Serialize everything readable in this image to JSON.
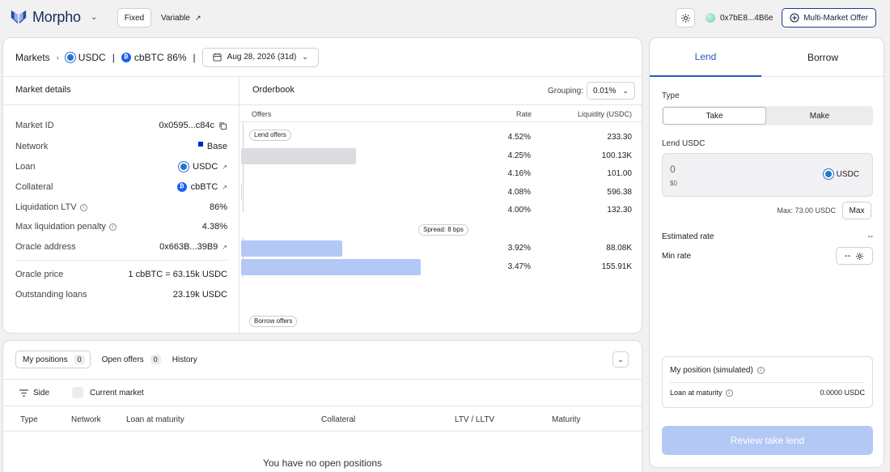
{
  "app": {
    "brand": "Morpho",
    "mode_fixed": "Fixed",
    "mode_variable": "Variable",
    "wallet": "0x7bE8...4B6e",
    "multi_market_offer": "Multi-Market Offer"
  },
  "market": {
    "breadcrumb_root": "Markets",
    "loan_token": "USDC",
    "collateral_token": "cbBTC",
    "ltv": "86%",
    "maturity": "Aug 28, 2026 (31d)"
  },
  "details": {
    "title": "Market details",
    "rows": [
      {
        "label": "Market ID",
        "value": "0x0595...c84c"
      },
      {
        "label": "Network",
        "value": "Base"
      },
      {
        "label": "Loan",
        "value": "USDC"
      },
      {
        "label": "Collateral",
        "value": "cbBTC"
      },
      {
        "label": "Liquidation LTV",
        "value": "86%"
      },
      {
        "label": "Max liquidation penalty",
        "value": "4.38%"
      },
      {
        "label": "Oracle address",
        "value": "0x663B...39B9"
      },
      {
        "label": "Oracle price",
        "value": "1 cbBTC = 63.15k USDC"
      },
      {
        "label": "Outstanding loans",
        "value": "23.19k USDC"
      }
    ]
  },
  "orderbook": {
    "title": "Orderbook",
    "grouping_label": "Grouping:",
    "grouping_value": "0.01%",
    "col_offers": "Offers",
    "col_rate": "Rate",
    "col_liquidity": "Liquidity (USDC)",
    "lend_tag": "Lend offers",
    "borrow_tag": "Borrow offers",
    "spread": "Spread: 8 bps",
    "lend_offers": [
      {
        "rate": "4.52%",
        "liquidity": "233.30",
        "depth": 0.001
      },
      {
        "rate": "4.25%",
        "liquidity": "100.13K",
        "depth": 0.64
      },
      {
        "rate": "4.16%",
        "liquidity": "101.00",
        "depth": 0.0006
      },
      {
        "rate": "4.08%",
        "liquidity": "596.38",
        "depth": 0.004
      },
      {
        "rate": "4.00%",
        "liquidity": "132.30",
        "depth": 0.0008
      }
    ],
    "borrow_offers": [
      {
        "rate": "3.92%",
        "liquidity": "88.08K",
        "depth": 0.565
      },
      {
        "rate": "3.47%",
        "liquidity": "155.91K",
        "depth": 1.0
      }
    ]
  },
  "positions": {
    "tab_my_positions": "My positions",
    "tab_my_positions_count": "0",
    "tab_open_offers": "Open offers",
    "tab_open_offers_count": "0",
    "tab_history": "History",
    "filter_side": "Side",
    "filter_current_market": "Current market",
    "columns": [
      "Type",
      "Network",
      "Loan at maturity",
      "Collateral",
      "LTV / LLTV",
      "Maturity"
    ],
    "empty": "You have no open positions"
  },
  "panel": {
    "tab_lend": "Lend",
    "tab_borrow": "Borrow",
    "type_label": "Type",
    "type_take": "Take",
    "type_make": "Make",
    "lend_label": "Lend USDC",
    "amount": "0",
    "amount_usd": "$0",
    "amount_token": "USDC",
    "max_text": "Max: 73.00 USDC",
    "max_button": "Max",
    "estimated_rate_label": "Estimated rate",
    "estimated_rate_value": "--",
    "min_rate_label": "Min rate",
    "min_rate_value": "--",
    "my_position_title": "My position (simulated)",
    "loan_at_maturity_label": "Loan at maturity",
    "loan_at_maturity_value": "0.0000 USDC",
    "review_button": "Review take lend"
  },
  "colors": {
    "accent": "#2b57c7",
    "lend_bar": "#dcdce0",
    "borrow_bar": "#b4c8f5",
    "network_base": "#0022dd"
  }
}
